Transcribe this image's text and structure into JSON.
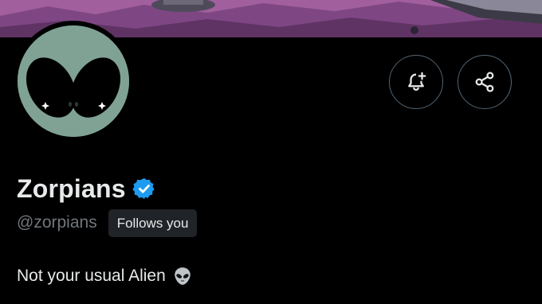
{
  "profile": {
    "display_name": "Zorpians",
    "handle": "@zorpians",
    "follows_you_label": "Follows you",
    "bio_text": "Not your usual Alien",
    "bio_emoji_icon": "alien-icon",
    "verified_icon": "verified-badge-icon"
  },
  "actions": {
    "notify_icon": "bell-plus-icon",
    "share_icon": "share-icon"
  },
  "colors": {
    "background": "#000000",
    "text_primary": "#e7e9ea",
    "text_secondary": "#71767b",
    "verified_blue": "#1d9bf0",
    "avatar_green": "#7fa294",
    "badge_bg": "#202327"
  }
}
